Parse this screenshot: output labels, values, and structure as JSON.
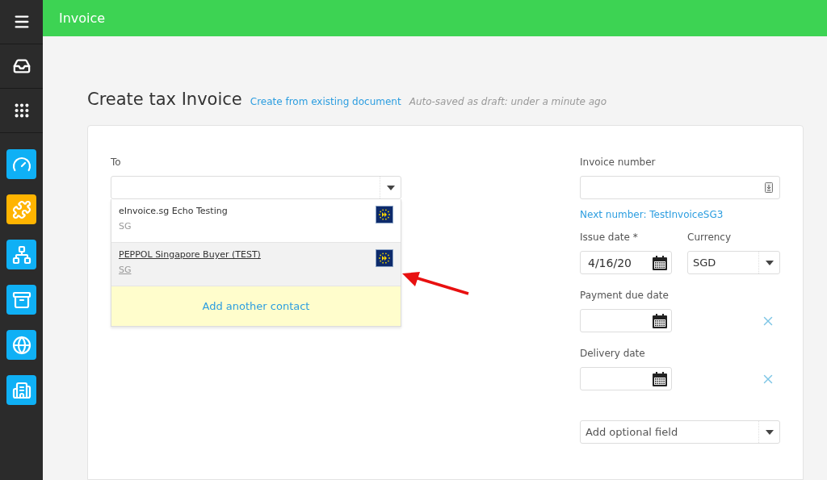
{
  "sidebar": {
    "apps": [
      {
        "color": "#0fb0f5"
      },
      {
        "color": "#ffb400"
      },
      {
        "color": "#0fb0f5"
      },
      {
        "color": "#0fb0f5"
      },
      {
        "color": "#0fb0f5"
      },
      {
        "color": "#0fb0f5"
      }
    ]
  },
  "header": {
    "title": "Invoice"
  },
  "page": {
    "title": "Create tax Invoice",
    "link": "Create from existing document",
    "status": "Auto-saved as draft: under a minute ago"
  },
  "to": {
    "label": "To",
    "options": [
      {
        "name": "eInvoice.sg Echo Testing",
        "country": "SG",
        "selected": false
      },
      {
        "name": "PEPPOL Singapore Buyer (TEST)",
        "country": "SG",
        "selected": true
      }
    ],
    "add_contact": "Add another contact"
  },
  "invoice_number": {
    "label": "Invoice number",
    "next": "Next number: TestInvoiceSG3"
  },
  "issue_date": {
    "label": "Issue date *",
    "value": "4/16/20"
  },
  "currency": {
    "label": "Currency",
    "value": "SGD"
  },
  "payment_due_date": {
    "label": "Payment due date"
  },
  "delivery_date": {
    "label": "Delivery date"
  },
  "optional_field": {
    "placeholder": "Add optional field"
  }
}
